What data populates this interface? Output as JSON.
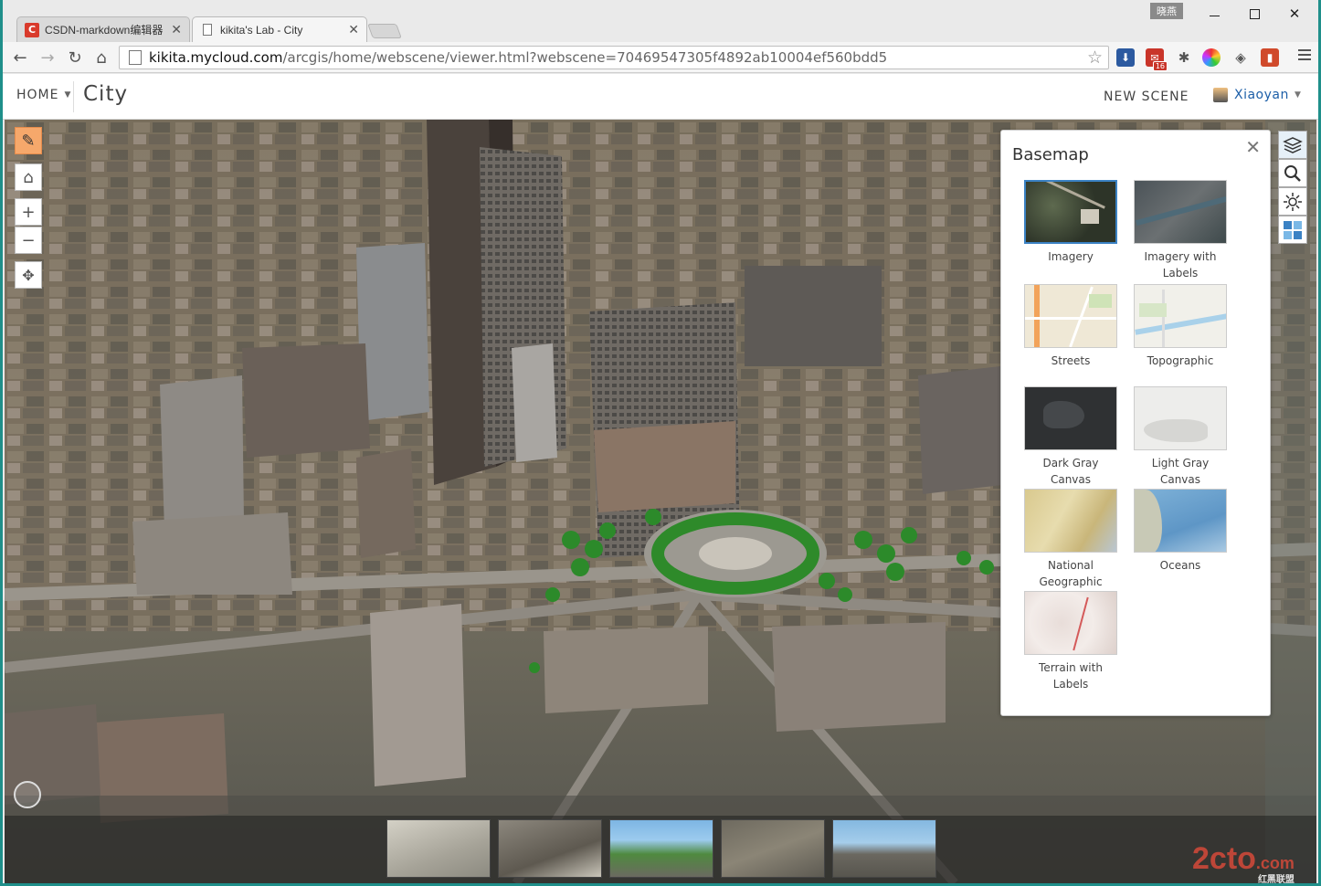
{
  "browser": {
    "profile_badge": "晓燕",
    "tabs": [
      {
        "title": "CSDN-markdown编辑器",
        "favicon": "C",
        "favicon_color": "#d93a2b",
        "active": false
      },
      {
        "title": "kikita's Lab - City",
        "favicon": "page-icon",
        "active": true
      }
    ],
    "address": {
      "domain": "kikita.mycloud.com",
      "path": "/arcgis/home/webscene/viewer.html?webscene=70469547305f4892ab10004ef560bdd5"
    },
    "mail_badge": "16"
  },
  "app": {
    "home_label": "HOME",
    "scene_title": "City",
    "new_scene_label": "NEW SCENE",
    "user_name": "Xiaoyan",
    "accent_color": "#f6a86b"
  },
  "basemap": {
    "title": "Basemap",
    "selected": "Imagery",
    "items": [
      {
        "label": "Imagery",
        "thumb": "imagery"
      },
      {
        "label": "Imagery with Labels",
        "thumb": "imagery-labels"
      },
      {
        "label": "Streets",
        "thumb": "streets"
      },
      {
        "label": "Topographic",
        "thumb": "topographic"
      },
      {
        "label": "Dark Gray Canvas",
        "thumb": "dark-gray"
      },
      {
        "label": "Light Gray Canvas",
        "thumb": "light-gray"
      },
      {
        "label": "National Geographic",
        "thumb": "natgeo"
      },
      {
        "label": "Oceans",
        "thumb": "oceans"
      },
      {
        "label": "Terrain with Labels",
        "thumb": "terrain"
      }
    ]
  },
  "watermark": {
    "text": "2cto",
    "suffix": ".com",
    "sub": "红黑联盟"
  }
}
